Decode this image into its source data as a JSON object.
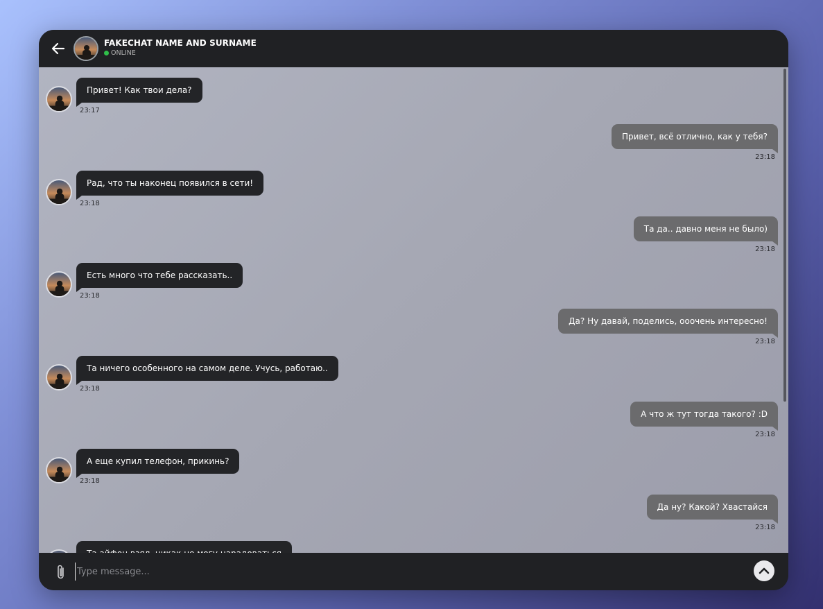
{
  "header": {
    "contact_name": "FAKECHAT NAME AND SURNAME",
    "status": "ONLINE",
    "back_icon": "arrow-left-icon",
    "status_color": "#2fbf4a"
  },
  "messages": [
    {
      "side": "in",
      "text": "Привет! Как твои дела?",
      "time": "23:17"
    },
    {
      "side": "out",
      "text": "Привет, всё отлично, как у тебя?",
      "time": "23:18"
    },
    {
      "side": "in",
      "text": "Рад, что ты наконец появился в сети!",
      "time": "23:18"
    },
    {
      "side": "out",
      "text": "Та да.. давно меня не было)",
      "time": "23:18"
    },
    {
      "side": "in",
      "text": "Есть много что тебе рассказать..",
      "time": "23:18"
    },
    {
      "side": "out",
      "text": "Да? Ну давай, поделись, ооочень интересно!",
      "time": "23:18"
    },
    {
      "side": "in",
      "text": "Та ничего особенного на самом деле. Учусь, работаю..",
      "time": "23:18"
    },
    {
      "side": "out",
      "text": "А что ж тут тогда такого? :D",
      "time": "23:18"
    },
    {
      "side": "in",
      "text": "А еще купил телефон, прикинь?",
      "time": "23:18"
    },
    {
      "side": "out",
      "text": "Да ну? Какой? Хвастайся",
      "time": "23:18"
    },
    {
      "side": "in",
      "text": "Та айфон взял, никак не могу нарадоваться",
      "time": ""
    }
  ],
  "composer": {
    "placeholder": "Type message...",
    "value": "",
    "attach_icon": "paperclip-icon",
    "send_icon": "chevron-up-icon"
  },
  "colors": {
    "incoming_bubble": "#232427",
    "outgoing_bubble": "#6b6b6d",
    "bar_background": "#202124"
  }
}
